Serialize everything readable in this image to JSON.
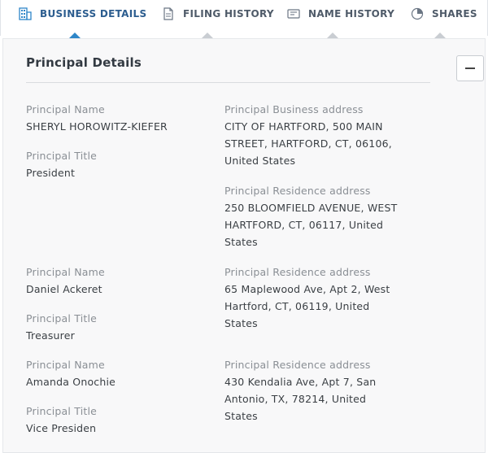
{
  "tabs": [
    {
      "label": "BUSINESS DETAILS",
      "icon": "building-icon",
      "active": true
    },
    {
      "label": "FILING HISTORY",
      "icon": "document-icon",
      "active": false
    },
    {
      "label": "NAME HISTORY",
      "icon": "id-card-icon",
      "active": false
    },
    {
      "label": "SHARES",
      "icon": "pie-chart-icon",
      "active": false
    }
  ],
  "section": {
    "title": "Principal Details",
    "collapse_symbol": "–"
  },
  "principals": [
    {
      "name_label": "Principal Name",
      "name": "SHERYL HOROWITZ-KIEFER",
      "title_label": "Principal Title",
      "title": "President",
      "business_address_label": "Principal Business address",
      "business_address": "CITY OF HARTFORD, 500 MAIN STREET, HARTFORD, CT, 06106, United States",
      "residence_address_label": "Principal Residence address",
      "residence_address": "250 BLOOMFIELD AVENUE, WEST HARTFORD, CT, 06117, United States"
    },
    {
      "name_label": "Principal Name",
      "name": "Daniel Ackeret",
      "title_label": "Principal Title",
      "title": "Treasurer",
      "residence_address_label": "Principal Residence address",
      "residence_address": "65 Maplewood Ave, Apt 2, West Hartford, CT, 06119, United States"
    },
    {
      "name_label": "Principal Name",
      "name": "Amanda Onochie",
      "title_label": "Principal Title",
      "title": "Vice Presiden",
      "residence_address_label": "Principal Residence address",
      "residence_address": "430 Kendalia Ave, Apt 7, San Antonio, TX, 78214, United States"
    }
  ],
  "colors": {
    "active_tab": "#2c5d8f",
    "tab_marker_active": "#2e86c8",
    "panel_bg": "#f8f8f9"
  }
}
